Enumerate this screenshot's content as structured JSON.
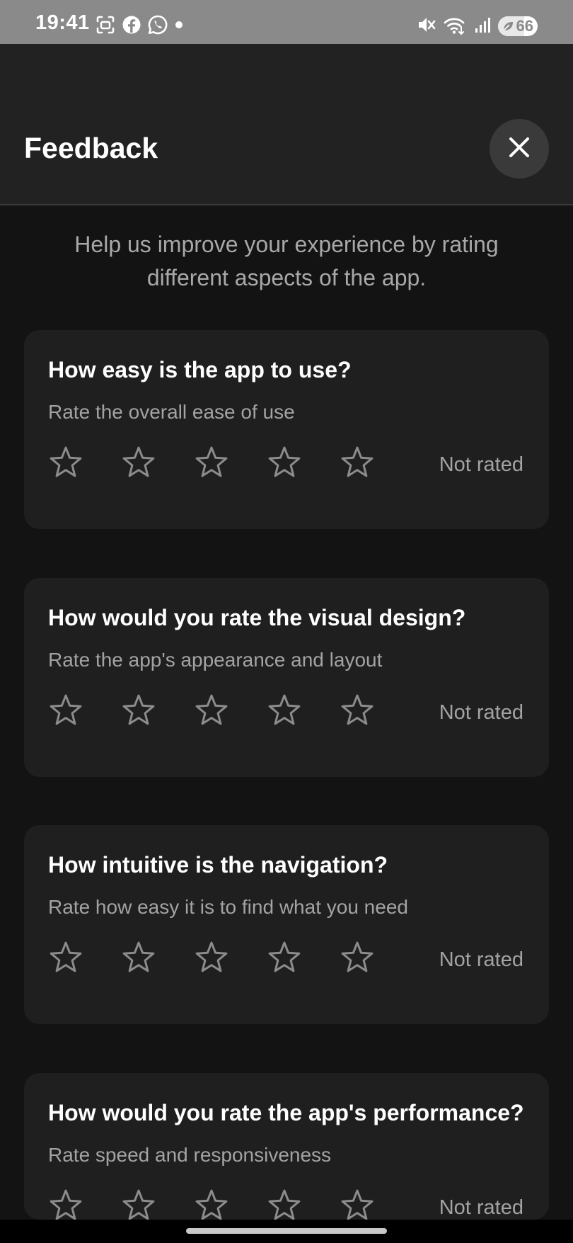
{
  "status_bar": {
    "time": "19:41",
    "left_icons": [
      "screenshot-icon",
      "facebook-icon",
      "whatsapp-icon",
      "dot-icon"
    ],
    "right_icons": [
      "mute-icon",
      "wifi-icon",
      "signal-icon"
    ],
    "battery": {
      "level": 66,
      "label": "66"
    }
  },
  "header": {
    "title": "Feedback",
    "close_icon": "close-icon"
  },
  "intro_text": "Help us improve your experience by rating different aspects of the app.",
  "questions": [
    {
      "title": "How easy is the app to use?",
      "subtitle": "Rate the overall ease of use",
      "rating": 0,
      "max_rating": 5,
      "status": "Not rated"
    },
    {
      "title": "How would you rate the visual design?",
      "subtitle": "Rate the app's appearance and layout",
      "rating": 0,
      "max_rating": 5,
      "status": "Not rated"
    },
    {
      "title": "How intuitive is the navigation?",
      "subtitle": "Rate how easy it is to find what you need",
      "rating": 0,
      "max_rating": 5,
      "status": "Not rated"
    },
    {
      "title": "How would you rate the app's performance?",
      "subtitle": "Rate speed and responsiveness",
      "rating": 0,
      "max_rating": 5,
      "status": "Not rated"
    }
  ],
  "colors": {
    "background": "#131313",
    "header": "#222222",
    "card": "#1f1f1f",
    "star_outline": "#8c8c8c",
    "muted_text": "#a3a3a3"
  }
}
